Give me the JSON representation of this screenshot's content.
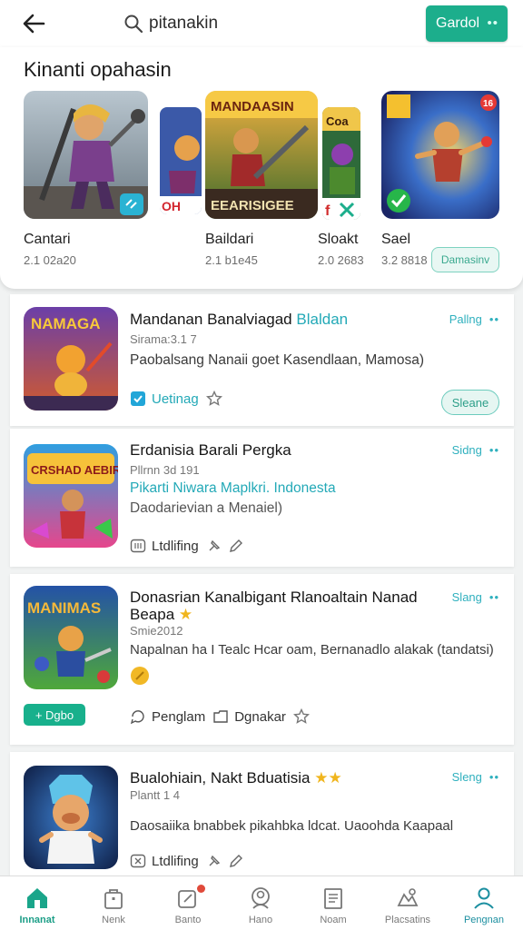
{
  "header": {
    "search_text": "pitanakin",
    "action_label": "Gardol",
    "action_dots": "••"
  },
  "featured": {
    "title": "Kinanti opahasin",
    "button_label": "Damasinv",
    "thumb_badge": "16",
    "items": [
      {
        "name": "Cantari",
        "meta": "2.1 02a20"
      },
      {
        "name": "Baildari",
        "meta": "2.1 b1e45"
      },
      {
        "name": "Sloakt",
        "meta": "2.0 2683"
      },
      {
        "name": "Sael",
        "meta": "3.2 8818"
      }
    ],
    "thumb_text": {
      "second_top": "MANDAASIN",
      "second_bottom": "EEARISIGEE",
      "third_label": "Coa"
    }
  },
  "list": [
    {
      "title": "Mandanan Banalviagad",
      "title_accent": "Blaldan",
      "meta": "Sirama:3.1 7",
      "desc": "Paobalsang Nanaii goet Kasendlaan, Mamosa)",
      "right_label": "Pallng",
      "right_dots": "••",
      "foot_label": "Uetinag",
      "pill_label": "Sleane",
      "art_text": "NAMAGA"
    },
    {
      "title": "Erdanisia Barali Pergka",
      "meta": "Pllrnn 3d 191",
      "desc_teal": "Pikarti Niwara Maplkri. Indonesta",
      "desc": "Daodarievian a Menaiel)",
      "right_label": "Sidng",
      "right_dots": "••",
      "foot_label": "Ltdlifing",
      "art_text": "CRSHAD AEBIRS"
    },
    {
      "title": "Donasrian Kanalbigant Rlanoaltain Nanad",
      "title_line2": "Beapa",
      "meta": "Smie2012",
      "desc": "Napalnan ha I Tealc Hcar oam, Bernanadlo alakak (tandatsi)",
      "right_label": "Slang",
      "right_dots": "••",
      "foot_label": "Penglam",
      "foot_label2": "Dgnakar",
      "green_label": "+ Dgbo",
      "art_text": "MANIMAS"
    },
    {
      "title": "Bualohiain, Nakt Bduatisia",
      "meta": "Plantt 1 4",
      "desc": "Daosaiika bnabbek pikahbka ldcat. Uaoohda Kaapaal",
      "right_label": "Sleng",
      "right_dots": "••",
      "foot_label": "Ltdlifing"
    }
  ],
  "bottomnav": [
    {
      "label": "Innanat"
    },
    {
      "label": "Nenk"
    },
    {
      "label": "Banto"
    },
    {
      "label": "Hano"
    },
    {
      "label": "Noam"
    },
    {
      "label": "Placsatins"
    },
    {
      "label": "Pengnan"
    }
  ],
  "colors": {
    "accent": "#1cae8c",
    "teal_text": "#23a9b7",
    "background": "#f1f3f3"
  }
}
